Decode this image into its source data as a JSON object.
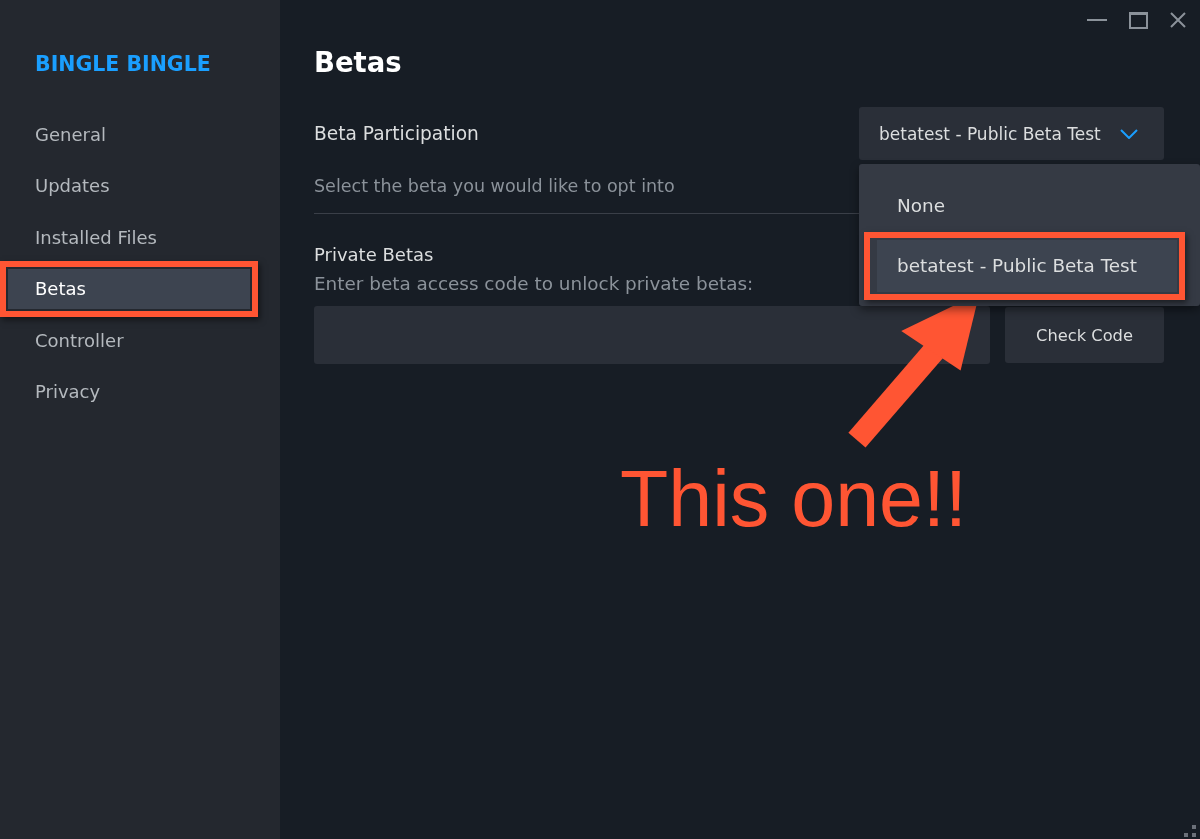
{
  "sidebar": {
    "title": "BINGLE BINGLE",
    "items": [
      {
        "label": "General",
        "selected": false,
        "highlighted": false
      },
      {
        "label": "Updates",
        "selected": false,
        "highlighted": false
      },
      {
        "label": "Installed Files",
        "selected": false,
        "highlighted": false
      },
      {
        "label": "Betas",
        "selected": true,
        "highlighted": true
      },
      {
        "label": "Controller",
        "selected": false,
        "highlighted": false
      },
      {
        "label": "Privacy",
        "selected": false,
        "highlighted": false
      }
    ]
  },
  "page": {
    "title": "Betas",
    "beta_participation": {
      "label": "Beta Participation",
      "dropdown": {
        "value": "betatest - Public Beta Test",
        "expanded": true,
        "options": [
          {
            "label": "None",
            "selected": false,
            "highlighted": false
          },
          {
            "label": "betatest - Public Beta Test",
            "selected": true,
            "highlighted": true
          }
        ]
      },
      "hint": "Select the beta you would like to opt into"
    },
    "private_betas": {
      "label": "Private Betas",
      "hint": "Enter beta access code to unlock private betas:",
      "button": "Check Code"
    }
  },
  "annotation": {
    "callout": "This one!!"
  }
}
